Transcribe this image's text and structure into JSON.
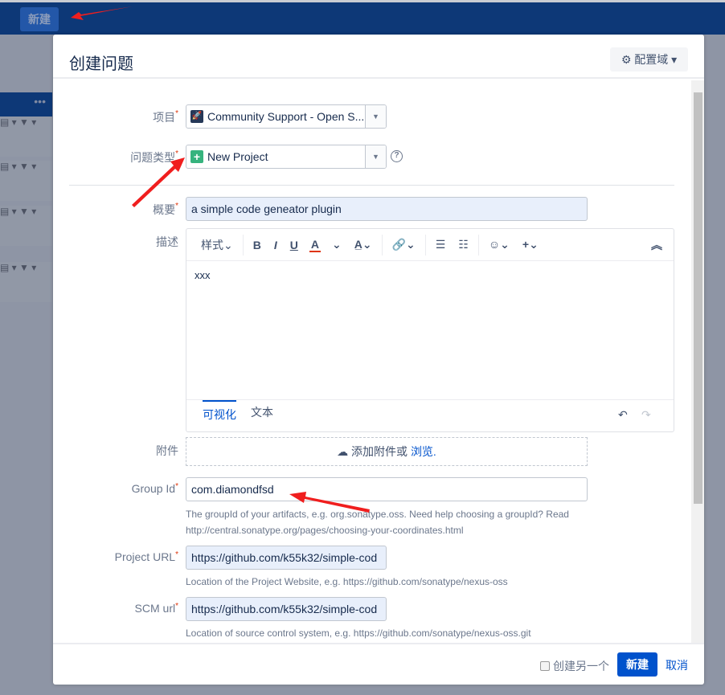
{
  "topbar": {
    "create_label": "新建"
  },
  "background": {
    "more": "•••"
  },
  "dialog": {
    "title": "创建问题",
    "configure_fields": "配置域",
    "fields": {
      "project": {
        "label": "项目",
        "value": "Community Support - Open S..."
      },
      "issue_type": {
        "label": "问题类型",
        "value": "New Project"
      },
      "summary": {
        "label": "概要",
        "value": "a simple code geneator plugin"
      },
      "description": {
        "label": "描述",
        "toolbar_style": "样式",
        "content": "xxx",
        "tab_visual": "可视化",
        "tab_text": "文本"
      },
      "attachment": {
        "label": "附件",
        "text": "添加附件或",
        "browse": "浏览."
      },
      "group_id": {
        "label": "Group Id",
        "value": "com.diamondfsd",
        "help_line1": "The groupId of your artifacts, e.g. org.sonatype.oss. Need help choosing a groupId? Read",
        "help_line2": "http://central.sonatype.org/pages/choosing-your-coordinates.html"
      },
      "project_url": {
        "label": "Project URL",
        "value": "https://github.com/k55k32/simple-cod",
        "help": "Location of the Project Website, e.g. https://github.com/sonatype/nexus-oss"
      },
      "scm_url": {
        "label": "SCM url",
        "value": "https://github.com/k55k32/simple-cod",
        "help": "Location of source control system, e.g. https://github.com/sonatype/nexus-oss.git"
      }
    },
    "footer": {
      "create_another": "创建另一个",
      "create": "新建",
      "cancel": "取消"
    }
  },
  "required_mark": "*"
}
